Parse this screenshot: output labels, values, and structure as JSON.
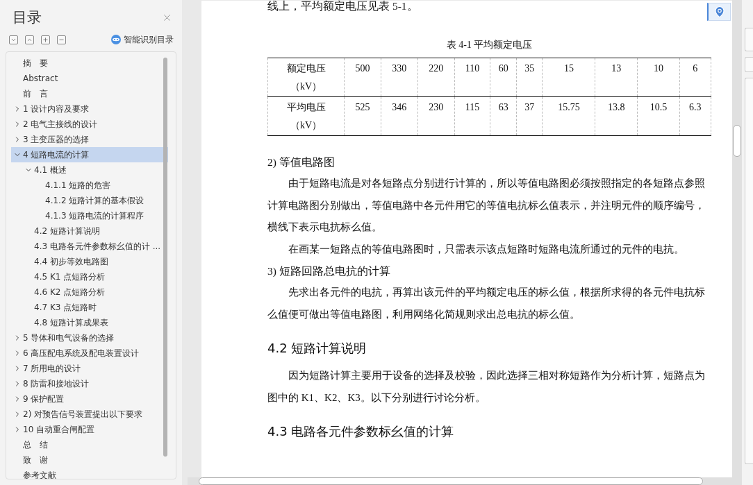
{
  "panel": {
    "title": "目录",
    "smart_button": "智能识别目录"
  },
  "toc": [
    {
      "label": "摘　要",
      "selected": false
    },
    {
      "label": "Abstract",
      "selected": false
    },
    {
      "label": "前　言",
      "selected": false
    },
    {
      "label": "1  设计内容及要求",
      "selected": false,
      "expanded": false
    },
    {
      "label": "2  电气主接线的设计",
      "selected": false,
      "expanded": false
    },
    {
      "label": "3  主变压器的选择",
      "selected": false,
      "expanded": false
    },
    {
      "label": "4  短路电流的计算",
      "selected": true,
      "expanded": true,
      "children": [
        {
          "label": "4.1  概述",
          "selected": false,
          "expanded": true,
          "children": [
            {
              "label": "4.1.1  短路的危害",
              "selected": false
            },
            {
              "label": "4.1.2  短路计算的基本假设",
              "selected": false
            },
            {
              "label": "4.1.3  短路电流的计算程序",
              "selected": false
            }
          ]
        },
        {
          "label": "4.2  短路计算说明",
          "selected": false
        },
        {
          "label": "4.3  电路各元件参数标幺值的计 ...",
          "selected": false
        },
        {
          "label": "4.4  初步等效电路图",
          "selected": false
        },
        {
          "label": "4.5 K1 点短路分析",
          "selected": false
        },
        {
          "label": "4.6 K2 点短路分析",
          "selected": false
        },
        {
          "label": "4.7 K3 点短路时",
          "selected": false
        },
        {
          "label": "4.8  短路计算成果表",
          "selected": false
        }
      ]
    },
    {
      "label": "5  导体和电气设备的选择",
      "selected": false,
      "expanded": false
    },
    {
      "label": "6  高压配电系统及配电装置设计",
      "selected": false,
      "expanded": false
    },
    {
      "label": "7  所用电的设计",
      "selected": false,
      "expanded": false
    },
    {
      "label": "8  防雷和接地设计",
      "selected": false,
      "expanded": false
    },
    {
      "label": "9  保护配置",
      "selected": false,
      "expanded": false
    },
    {
      "label": "2)  对预告信号装置提出以下要求",
      "selected": false,
      "expanded": false
    },
    {
      "label": "10  自动重合闸配置",
      "selected": false,
      "expanded": false
    },
    {
      "label": "总　结",
      "selected": false
    },
    {
      "label": "致　谢",
      "selected": false
    },
    {
      "label": "参考文献",
      "selected": false
    }
  ],
  "document": [
    {
      "kind": "text",
      "text": "线上，平均额定电压见表 5-1。"
    },
    {
      "kind": "caption",
      "text": "表 4-1   平均额定电压"
    },
    {
      "kind": "table",
      "rows": [
        {
          "label": "额定电压",
          "unit": "（kV）",
          "cells": [
            "500",
            "330",
            "220",
            "110",
            "60",
            "35",
            "15",
            "13",
            "10",
            "6"
          ]
        },
        {
          "label": "平均电压",
          "unit": "（kV）",
          "cells": [
            "525",
            "346",
            "230",
            "115",
            "63",
            "37",
            "15.75",
            "13.8",
            "10.5",
            "6.3"
          ]
        }
      ]
    },
    {
      "kind": "item",
      "text": "2)  等值电路图"
    },
    {
      "kind": "para",
      "text": "由于短路电流是对各短路点分别进行计算的，所以等值电路图必须按照指定的各短路点参照计算电路图分别做出，等值电路中各元件用它的等值电抗标么值表示，并注明元件的顺序编号，横线下表示电抗标么值。"
    },
    {
      "kind": "para",
      "text": "在画某一短路点的等值电路图时，只需表示该点短路时短路电流所通过的元件的电抗。"
    },
    {
      "kind": "item",
      "text": "3)  短路回路总电抗的计算"
    },
    {
      "kind": "para",
      "text": "先求出各元件的电抗，再算出该元件的平均额定电压的标么值，根据所求得的各元件电抗标么值便可做出等值电路图，利用网络化简规则求出总电抗的标么值。"
    },
    {
      "kind": "heading",
      "text": "4.2  短路计算说明"
    },
    {
      "kind": "para",
      "text": "因为短路计算主要用于设备的选择及校验，因此选择三相对称短路作为分析计算，短路点为图中的 K1、K2、K3。以下分别进行讨论分析。"
    },
    {
      "kind": "heading",
      "text": "4.3  电路各元件参数标幺值的计算"
    }
  ]
}
